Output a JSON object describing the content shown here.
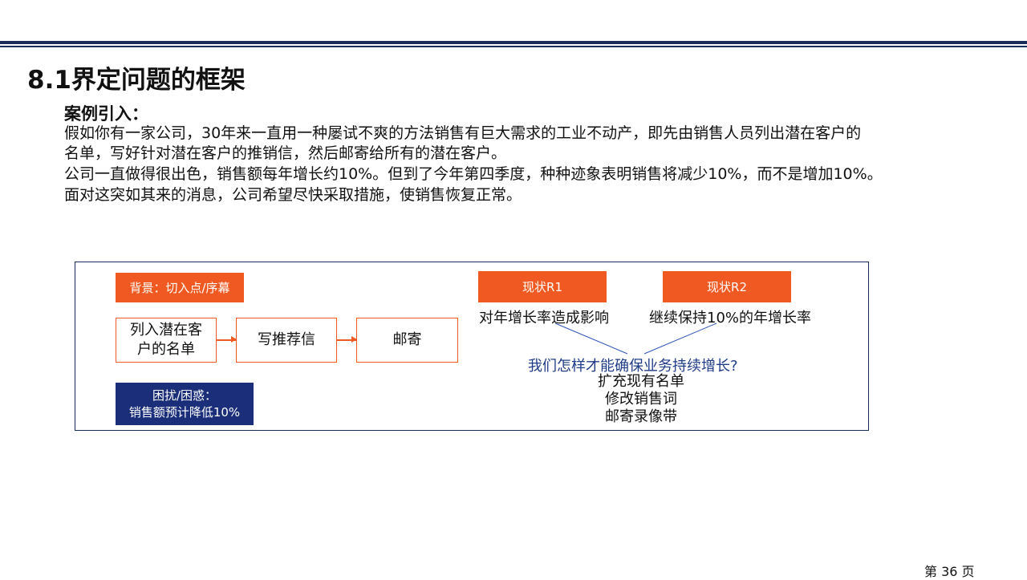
{
  "title": "8.1界定问题的框架",
  "case": {
    "heading": "案例引入：",
    "paragraph1_line1": "假如你有一家公司，30年来一直用一种屡试不爽的方法销售有巨大需求的工业不动产，即先由销售人员列出潜在客户的",
    "paragraph1_line2": "名单，写好针对潜在客户的推销信，然后邮寄给所有的潜在客户。",
    "paragraph2": "公司一直做得很出色，销售额每年增长约10%。但到了今年第四季度，种种迹象表明销售将减少10%，而不是增加10%。",
    "paragraph3": "面对这突如其来的消息，公司希望尽快采取措施，使销售恢复正常。"
  },
  "framework": {
    "background_label": "背景：切入点/序幕",
    "steps": [
      "列入潜在客户的名单",
      "写推荐信",
      "邮寄"
    ],
    "trouble_line1": "困扰/困惑：",
    "trouble_line2": "销售额预计降低10%",
    "r1_label": "现状R1",
    "r1_text": "对年增长率造成影响",
    "r2_label": "现状R2",
    "r2_text": "继续保持10%的年增长率",
    "question": "我们怎样才能确保业务持续增长?",
    "answers": [
      "扩充现有名单",
      "修改销售词",
      "邮寄录像带"
    ]
  },
  "page_number": "第 36 页",
  "colors": {
    "navy": "#1b2e57",
    "orange": "#f05a22",
    "question_blue": "#1f3c88",
    "trouble_blue": "#1b2e7a"
  }
}
